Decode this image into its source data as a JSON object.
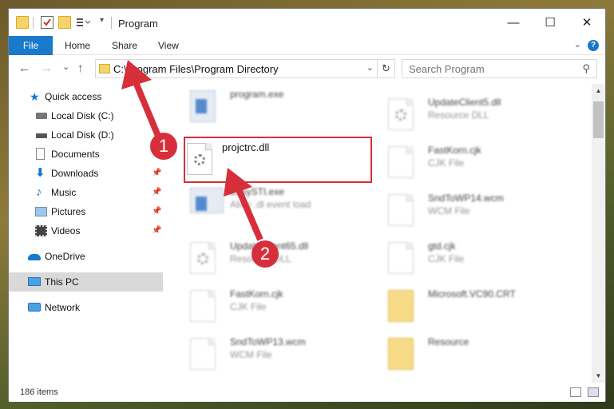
{
  "window": {
    "title": "Program"
  },
  "ribbon": {
    "tabs": [
      "File",
      "Home",
      "Share",
      "View"
    ],
    "help": "?"
  },
  "nav": {
    "back": "←",
    "forward": "→",
    "recent": "⌄",
    "up": "↑"
  },
  "address": {
    "path": "C:\\Program Files\\Program Directory",
    "refresh": "↻"
  },
  "search": {
    "placeholder": "Search Program"
  },
  "sidebar": {
    "items": [
      {
        "label": "Quick access",
        "icon": "star-icon",
        "pinned": false
      },
      {
        "label": "Local Disk (C:)",
        "icon": "drive-icon",
        "pinned": false
      },
      {
        "label": "Local Disk (D:)",
        "icon": "drive-icon",
        "pinned": false
      },
      {
        "label": "Documents",
        "icon": "documents-icon",
        "pinned": true
      },
      {
        "label": "Downloads",
        "icon": "download-icon",
        "pinned": true
      },
      {
        "label": "Music",
        "icon": "music-icon",
        "pinned": true
      },
      {
        "label": "Pictures",
        "icon": "pictures-icon",
        "pinned": true
      },
      {
        "label": "Videos",
        "icon": "videos-icon",
        "pinned": true
      },
      {
        "label": "OneDrive",
        "icon": "cloud-icon",
        "pinned": false
      },
      {
        "label": "This PC",
        "icon": "pc-icon",
        "pinned": false,
        "selected": true
      },
      {
        "label": "Network",
        "icon": "network-icon",
        "pinned": false
      }
    ]
  },
  "files": {
    "left": [
      {
        "name": "program.exe",
        "type": "",
        "icon": "exe-icon"
      },
      {
        "name": "projctrc.dll",
        "type": "",
        "icon": "dll-gear-icon"
      },
      {
        "name": "EasySTI.exe",
        "type": "Alien .dl event load",
        "icon": "exe-icon"
      },
      {
        "name": "UpdateClient65.dll",
        "type": "Resource DLL",
        "icon": "dll-gear-icon"
      },
      {
        "name": "FastKorn.cjk",
        "type": "CJK File",
        "icon": "file-icon"
      },
      {
        "name": "SndToWP13.wcm",
        "type": "WCM File",
        "icon": "file-icon"
      }
    ],
    "right": [
      {
        "name": "UpdateClient5.dll",
        "type": "Resource DLL",
        "icon": "dll-gear-icon"
      },
      {
        "name": "FastKorn.cjk",
        "type": "CJK File",
        "icon": "file-icon"
      },
      {
        "name": "SndToWP14.wcm",
        "type": "WCM File",
        "icon": "file-icon"
      },
      {
        "name": "gtd.cjk",
        "type": "CJK File",
        "icon": "file-icon"
      },
      {
        "name": "Microsoft.VC90.CRT",
        "type": "",
        "icon": "folder-icon"
      },
      {
        "name": "Resource",
        "type": "",
        "icon": "folder-icon"
      }
    ]
  },
  "status": {
    "item_count": "186 items"
  },
  "annotations": {
    "step1": "1",
    "step2": "2",
    "color": "#d62f3b"
  },
  "colors": {
    "accent": "#1979ca",
    "highlight": "#d62f3b"
  }
}
